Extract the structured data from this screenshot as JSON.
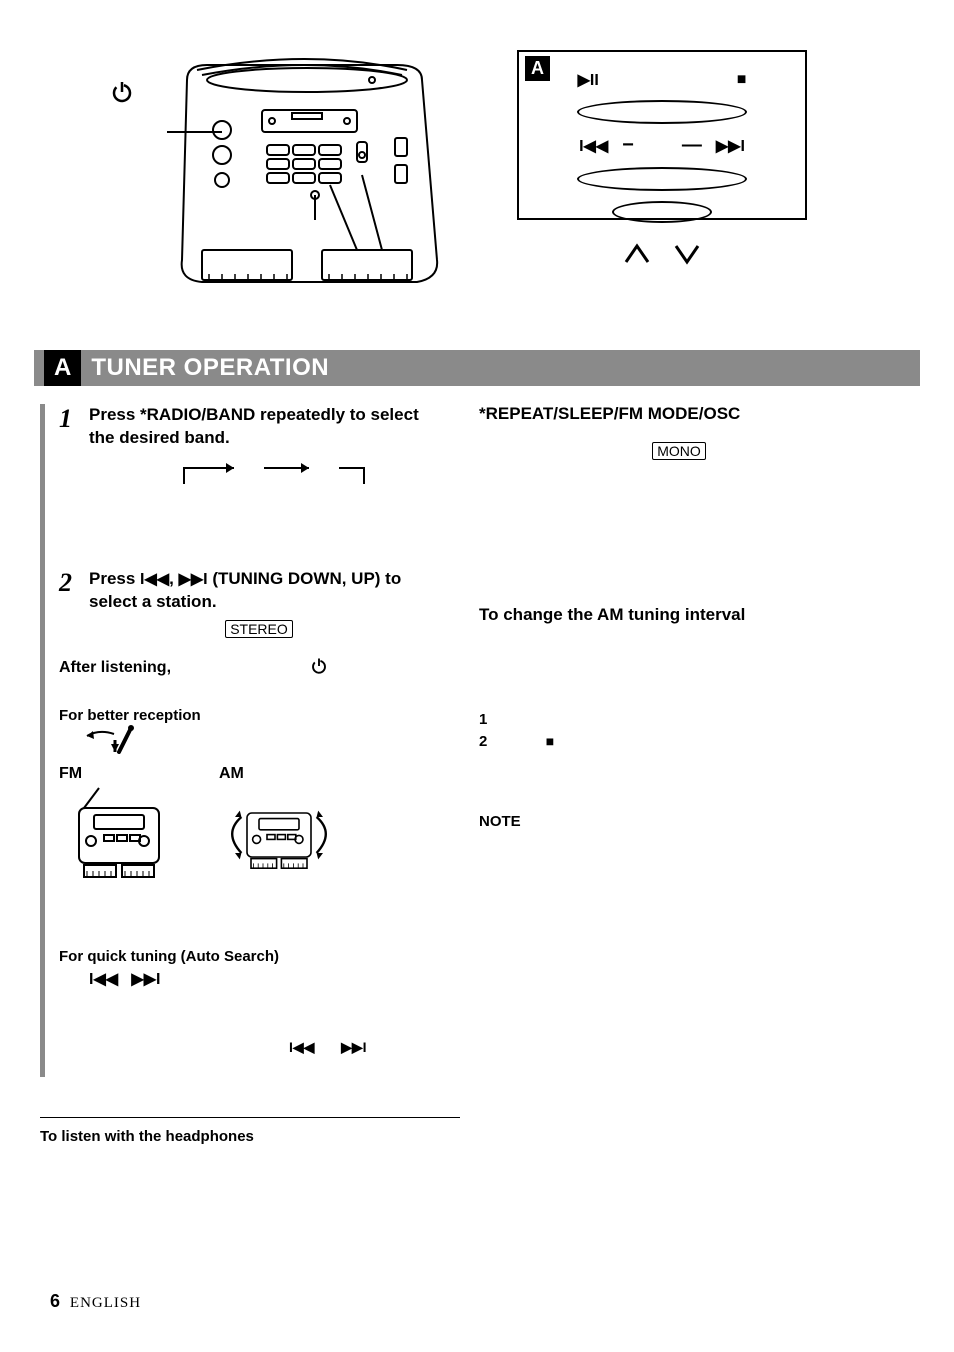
{
  "tag_letter": "A",
  "section": {
    "letter": "A",
    "title": "TUNER OPERATION"
  },
  "left": {
    "step1": {
      "num": "1",
      "line1": "Press *RADIO/BAND repeatedly to select",
      "line2": "the desired band."
    },
    "step2": {
      "num": "2",
      "line1_a": "Press ",
      "line1_b": ", ",
      "line1_c": " (TUNING DOWN, UP) to",
      "line2": "select a station."
    },
    "stereo_label": "STEREO",
    "after_listening": "After listening,",
    "reception_heading": "For better reception",
    "fm_label": "FM",
    "am_label": "AM",
    "auto_search_heading": "For quick tuning (Auto Search)"
  },
  "right": {
    "heading": "*REPEAT/SLEEP/FM MODE/OSC",
    "mono_label": "MONO",
    "am_interval_heading": "To change the AM tuning interval",
    "list1": "1",
    "list2": "2",
    "note_heading": "NOTE"
  },
  "footer": {
    "headphones": "To listen with the headphones",
    "page": "6",
    "lang": "ENGLISH"
  }
}
